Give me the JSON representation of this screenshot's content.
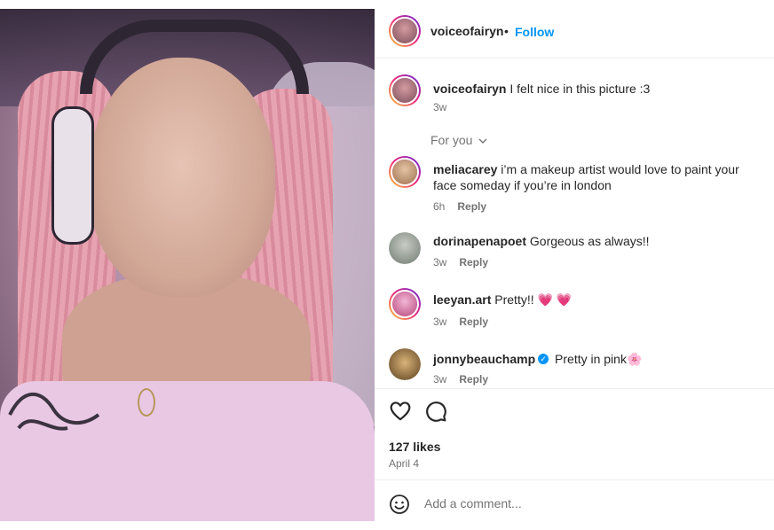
{
  "post": {
    "author": "voiceofairyn",
    "follow_label": "Follow",
    "dot": "•",
    "caption_user": "voiceofairyn",
    "caption_text": "I felt nice in this picture :3",
    "caption_time": "3w",
    "for_you_label": "For you",
    "likes": "127 likes",
    "date": "April 4",
    "add_comment_placeholder": "Add a comment..."
  },
  "comments": [
    {
      "user": "meliacarey",
      "text": "i’m a makeup artist would love to paint your face someday if you’re in london",
      "time": "6h",
      "reply": "Reply",
      "story_ring": true,
      "avatar_color": "#c9a07a"
    },
    {
      "user": "dorinapenapoet",
      "text": "Gorgeous as always!!",
      "time": "3w",
      "reply": "Reply",
      "story_ring": false,
      "avatar_color": "#9aa39a"
    },
    {
      "user": "leeyan.art",
      "text": "Pretty!! 💗 💗",
      "time": "3w",
      "reply": "Reply",
      "story_ring": true,
      "avatar_color": "#e58fb8"
    },
    {
      "user": "jonnybeauchamp",
      "text": "Pretty in pink🌸",
      "time": "3w",
      "reply": "Reply",
      "story_ring": false,
      "verified": true,
      "avatar_color": "#7a5a2e"
    }
  ],
  "colors": {
    "accent": "#0095f6",
    "muted": "#737373",
    "text": "#262626"
  },
  "icons": [
    "heart-icon",
    "comment-icon",
    "emoji-icon",
    "chevron-down-icon",
    "verified-badge-icon"
  ]
}
